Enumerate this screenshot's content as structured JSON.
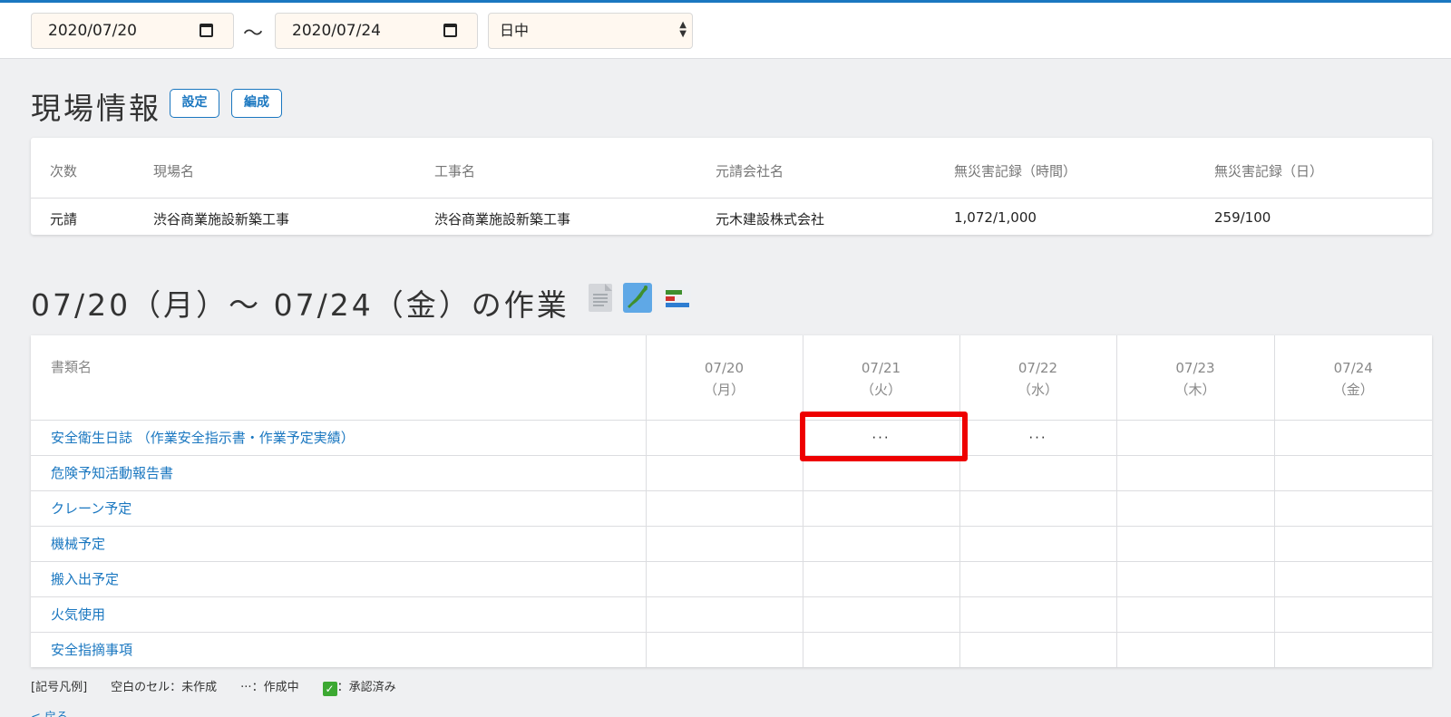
{
  "filters": {
    "start_date": "2020/07/20",
    "range_separator": "〜",
    "end_date": "2020/07/24",
    "shift": "日中"
  },
  "site_info": {
    "title": "現場情報",
    "settings_button": "設定",
    "edit_button": "編成",
    "columns": [
      "次数",
      "現場名",
      "工事名",
      "元請会社名",
      "無災害記録（時間）",
      "無災害記録（日）"
    ],
    "row": [
      "元請",
      "渋谷商業施設新築工事",
      "渋谷商業施設新築工事",
      "元木建設株式会社",
      "1,072/1,000",
      "259/100"
    ]
  },
  "work": {
    "title": "07/20（月）〜 07/24（金）の作業",
    "icons": [
      "document-icon",
      "japan-map-icon",
      "bar-chart-icon"
    ],
    "doc_header": "書類名",
    "days": [
      {
        "date": "07/20",
        "weekday": "（月）"
      },
      {
        "date": "07/21",
        "weekday": "（火）"
      },
      {
        "date": "07/22",
        "weekday": "（水）"
      },
      {
        "date": "07/23",
        "weekday": "（木）"
      },
      {
        "date": "07/24",
        "weekday": "（金）"
      }
    ],
    "rows": [
      {
        "name": "安全衛生日誌 （作業安全指示書・作業予定実績）",
        "cells": [
          "",
          "···",
          "···",
          "",
          ""
        ]
      },
      {
        "name": "危険予知活動報告書",
        "cells": [
          "",
          "",
          "",
          "",
          ""
        ]
      },
      {
        "name": "クレーン予定",
        "cells": [
          "",
          "",
          "",
          "",
          ""
        ]
      },
      {
        "name": "機械予定",
        "cells": [
          "",
          "",
          "",
          "",
          ""
        ]
      },
      {
        "name": "搬入出予定",
        "cells": [
          "",
          "",
          "",
          "",
          ""
        ]
      },
      {
        "name": "火気使用",
        "cells": [
          "",
          "",
          "",
          "",
          ""
        ]
      },
      {
        "name": "安全指摘事項",
        "cells": [
          "",
          "",
          "",
          "",
          ""
        ]
      }
    ]
  },
  "legend": {
    "label": "[記号凡例]",
    "empty": "空白のセル：未作成",
    "in_progress": "···：作成中",
    "approved": "：承認済み"
  },
  "back_link": "< 戻る",
  "colors": {
    "accent": "#1a77c0",
    "highlight": "#ee0000",
    "input_bg": "#fff8f0"
  }
}
